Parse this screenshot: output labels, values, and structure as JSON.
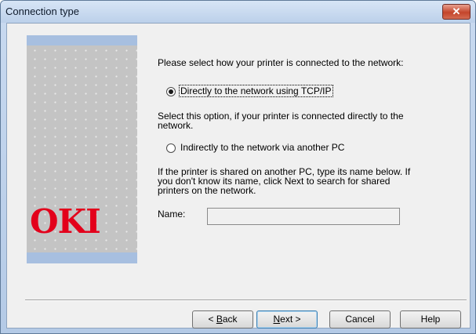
{
  "window": {
    "title": "Connection type",
    "close_glyph": "✕"
  },
  "banner": {
    "logo_text": "OKI",
    "logo_color": "#e3001b"
  },
  "content": {
    "prompt": "Please select how your printer is connected to the network:",
    "option_direct": {
      "label": "Directly to the network using TCP/IP",
      "selected": true
    },
    "option_direct_help": "Select this option, if your printer is connected directly to the network.",
    "option_indirect": {
      "label": "Indirectly to the network via another PC",
      "selected": false
    },
    "shared_help": "If the printer is shared on another PC, type its name below. If you don't know its name, click Next to search for shared printers on the network.",
    "name_label": "Name:",
    "name_value": ""
  },
  "buttons": {
    "back_mnemonic": "B",
    "back_rest": "ack",
    "back_prefix": "< ",
    "next_mnemonic": "N",
    "next_rest": "ext >",
    "cancel": "Cancel",
    "help": "Help"
  }
}
